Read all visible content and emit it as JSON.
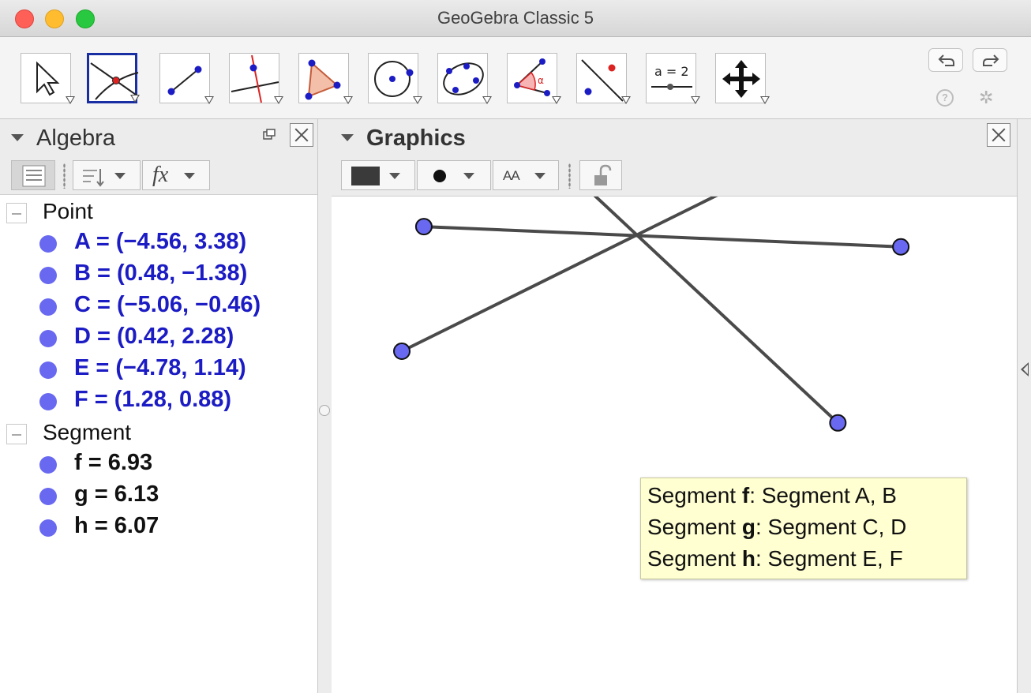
{
  "window": {
    "title": "GeoGebra Classic 5"
  },
  "toolbar": {
    "tools": [
      {
        "icon": "move-arrow-icon",
        "selected": false
      },
      {
        "icon": "point-intersect-icon",
        "selected": true
      },
      {
        "icon": "line-through-two-points-icon",
        "selected": false
      },
      {
        "icon": "perpendicular-line-icon",
        "selected": false
      },
      {
        "icon": "polygon-icon",
        "selected": false
      },
      {
        "icon": "circle-center-point-icon",
        "selected": false
      },
      {
        "icon": "conic-five-points-icon",
        "selected": false
      },
      {
        "icon": "angle-icon",
        "selected": false
      },
      {
        "icon": "reflect-about-line-icon",
        "selected": false
      },
      {
        "icon": "slider-icon",
        "selected": false,
        "label": "a = 2"
      },
      {
        "icon": "move-graphics-view-icon",
        "selected": false
      }
    ]
  },
  "algebra": {
    "title": "Algebra",
    "groups": [
      {
        "label": "Point",
        "items": [
          "A = (−4.56, 3.38)",
          "B = (0.48, −1.38)",
          "C = (−5.06, −0.46)",
          "D = (0.42, 2.28)",
          "E = (−4.78, 1.14)",
          "F = (1.28, 0.88)"
        ]
      },
      {
        "label": "Segment",
        "items": [
          "f = 6.93",
          "g = 6.13",
          "h = 6.07"
        ]
      }
    ]
  },
  "graphics": {
    "title": "Graphics",
    "style_bar": {
      "fx_label": "fx",
      "text_style_label": "AA"
    },
    "tooltip": [
      {
        "prefix": "Segment ",
        "name": "f",
        "suffix": ": Segment A, B"
      },
      {
        "prefix": "Segment ",
        "name": "g",
        "suffix": ": Segment C, D"
      },
      {
        "prefix": "Segment ",
        "name": "h",
        "suffix": ": Segment E, F"
      }
    ]
  },
  "colors": {
    "point_fill": "#6868f0",
    "point_text": "#1c1cc4",
    "segment_stroke": "#4a4a4a",
    "tool_selected_border": "#1a2ea3",
    "tooltip_bg": "#ffffd2"
  }
}
